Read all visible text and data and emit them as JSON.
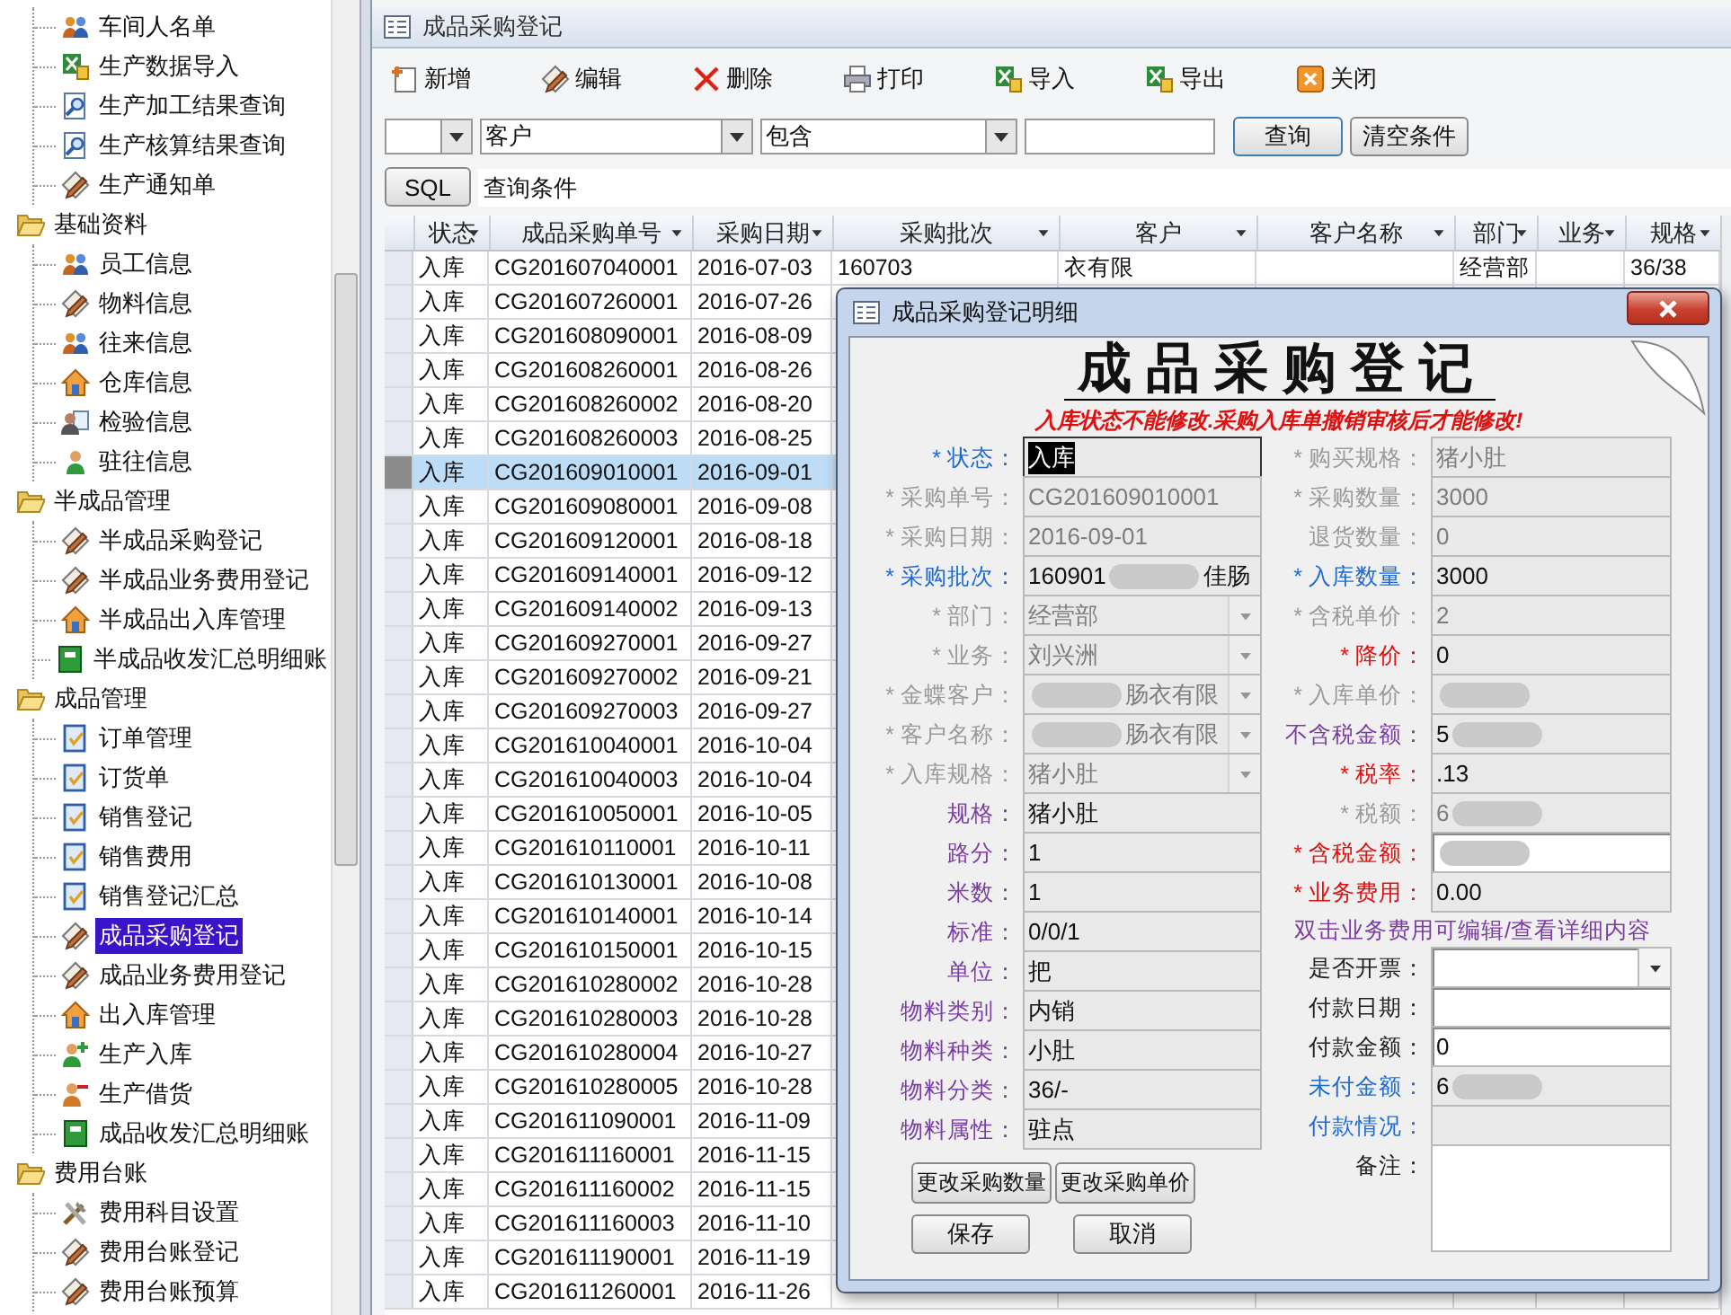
{
  "tree": [
    {
      "expanded": true,
      "children": [
        {
          "label": "车间人名单",
          "kind": "people",
          "selected": false
        },
        {
          "label": "生产数据导入",
          "kind": "excel",
          "selected": false
        },
        {
          "label": "生产加工结果查询",
          "kind": "search-doc",
          "selected": false
        },
        {
          "label": "生产核算结果查询",
          "kind": "search-doc",
          "selected": false
        },
        {
          "label": "生产通知单",
          "kind": "form",
          "selected": false
        }
      ]
    },
    {
      "label": "基础资料",
      "expanded": true,
      "children": [
        {
          "label": "员工信息",
          "kind": "people",
          "selected": false
        },
        {
          "label": "物料信息",
          "kind": "form",
          "selected": false
        },
        {
          "label": "往来信息",
          "kind": "people",
          "selected": false
        },
        {
          "label": "仓库信息",
          "kind": "house",
          "selected": false
        },
        {
          "label": "检验信息",
          "kind": "person-card",
          "selected": false
        },
        {
          "label": "驻往信息",
          "kind": "person",
          "selected": false
        }
      ]
    },
    {
      "label": "半成品管理",
      "expanded": true,
      "children": [
        {
          "label": "半成品采购登记",
          "kind": "form",
          "selected": false
        },
        {
          "label": "半成品业务费用登记",
          "kind": "form",
          "selected": false
        },
        {
          "label": "半成品出入库管理",
          "kind": "house",
          "selected": false
        },
        {
          "label": "半成品收发汇总明细账",
          "kind": "ledger",
          "selected": false
        }
      ]
    },
    {
      "label": "成品管理",
      "expanded": true,
      "children": [
        {
          "label": "订单管理",
          "kind": "check-doc",
          "selected": false
        },
        {
          "label": "订货单",
          "kind": "check-doc",
          "selected": false
        },
        {
          "label": "销售登记",
          "kind": "check-doc",
          "selected": false
        },
        {
          "label": "销售费用",
          "kind": "check-doc",
          "selected": false
        },
        {
          "label": "销售登记汇总",
          "kind": "check-doc",
          "selected": false
        },
        {
          "label": "成品采购登记",
          "kind": "form",
          "selected": true
        },
        {
          "label": "成品业务费用登记",
          "kind": "form",
          "selected": false
        },
        {
          "label": "出入库管理",
          "kind": "house",
          "selected": false
        },
        {
          "label": "生产入库",
          "kind": "person-add",
          "selected": false
        },
        {
          "label": "生产借货",
          "kind": "person-minus",
          "selected": false
        },
        {
          "label": "成品收发汇总明细账",
          "kind": "ledger",
          "selected": false
        }
      ]
    },
    {
      "label": "费用台账",
      "expanded": true,
      "children": [
        {
          "label": "费用科目设置",
          "kind": "tools",
          "selected": false
        },
        {
          "label": "费用台账登记",
          "kind": "form",
          "selected": false
        },
        {
          "label": "费用台账预算",
          "kind": "form",
          "selected": false
        }
      ]
    }
  ],
  "window": {
    "title": "成品采购登记"
  },
  "toolbar": [
    {
      "label": "新增",
      "kind": "new"
    },
    {
      "label": "编辑",
      "kind": "form"
    },
    {
      "label": "删除",
      "kind": "delete"
    },
    {
      "label": "打印",
      "kind": "print"
    },
    {
      "label": "导入",
      "kind": "excel"
    },
    {
      "label": "导出",
      "kind": "excel"
    },
    {
      "label": "关闭",
      "kind": "close"
    }
  ],
  "filters": {
    "field": "客户",
    "operator": "包含",
    "search_button": "查询",
    "clear_button": "清空条件",
    "sql_button": "SQL",
    "condition": "查询条件"
  },
  "table": {
    "columns": [
      "状态",
      "成品采购单号",
      "采购日期",
      "采购批次",
      "客户",
      "客户名称",
      "部门",
      "业务",
      "规格"
    ],
    "rows": [
      {
        "status": "入库",
        "number": "CG201607040001",
        "date": "2016-07-03",
        "batch": "160703",
        "customer": "衣有限",
        "department": "经营部",
        "spec": "36/38",
        "selected": false
      },
      {
        "status": "入库",
        "number": "CG201607260001",
        "date": "2016-07-26",
        "selected": false
      },
      {
        "status": "入库",
        "number": "CG201608090001",
        "date": "2016-08-09",
        "selected": false
      },
      {
        "status": "入库",
        "number": "CG201608260001",
        "date": "2016-08-26",
        "selected": false
      },
      {
        "status": "入库",
        "number": "CG201608260002",
        "date": "2016-08-20",
        "selected": false
      },
      {
        "status": "入库",
        "number": "CG201608260003",
        "date": "2016-08-25",
        "selected": false
      },
      {
        "status": "入库",
        "number": "CG201609010001",
        "date": "2016-09-01",
        "selected": true
      },
      {
        "status": "入库",
        "number": "CG201609080001",
        "date": "2016-09-08",
        "selected": false
      },
      {
        "status": "入库",
        "number": "CG201609120001",
        "date": "2016-08-18",
        "selected": false
      },
      {
        "status": "入库",
        "number": "CG201609140001",
        "date": "2016-09-12",
        "selected": false
      },
      {
        "status": "入库",
        "number": "CG201609140002",
        "date": "2016-09-13",
        "selected": false
      },
      {
        "status": "入库",
        "number": "CG201609270001",
        "date": "2016-09-27",
        "selected": false
      },
      {
        "status": "入库",
        "number": "CG201609270002",
        "date": "2016-09-21",
        "selected": false
      },
      {
        "status": "入库",
        "number": "CG201609270003",
        "date": "2016-09-27",
        "selected": false
      },
      {
        "status": "入库",
        "number": "CG201610040001",
        "date": "2016-10-04",
        "selected": false
      },
      {
        "status": "入库",
        "number": "CG201610040003",
        "date": "2016-10-04",
        "selected": false
      },
      {
        "status": "入库",
        "number": "CG201610050001",
        "date": "2016-10-05",
        "selected": false
      },
      {
        "status": "入库",
        "number": "CG201610110001",
        "date": "2016-10-11",
        "selected": false
      },
      {
        "status": "入库",
        "number": "CG201610130001",
        "date": "2016-10-08",
        "selected": false
      },
      {
        "status": "入库",
        "number": "CG201610140001",
        "date": "2016-10-14",
        "selected": false
      },
      {
        "status": "入库",
        "number": "CG201610150001",
        "date": "2016-10-15",
        "selected": false
      },
      {
        "status": "入库",
        "number": "CG201610280002",
        "date": "2016-10-28",
        "selected": false
      },
      {
        "status": "入库",
        "number": "CG201610280003",
        "date": "2016-10-28",
        "selected": false
      },
      {
        "status": "入库",
        "number": "CG201610280004",
        "date": "2016-10-27",
        "selected": false
      },
      {
        "status": "入库",
        "number": "CG201610280005",
        "date": "2016-10-28",
        "selected": false
      },
      {
        "status": "入库",
        "number": "CG201611090001",
        "date": "2016-11-09",
        "selected": false
      },
      {
        "status": "入库",
        "number": "CG201611160001",
        "date": "2016-11-15",
        "selected": false
      },
      {
        "status": "入库",
        "number": "CG201611160002",
        "date": "2016-11-15",
        "selected": false
      },
      {
        "status": "入库",
        "number": "CG201611160003",
        "date": "2016-11-10",
        "selected": false
      },
      {
        "status": "入库",
        "number": "CG201611190001",
        "date": "2016-11-19",
        "selected": false
      },
      {
        "status": "入库",
        "number": "CG201611260001",
        "date": "2016-11-26",
        "selected": false
      }
    ]
  },
  "detail": {
    "title": "成品采购登记明细",
    "heading": "成品采购登记",
    "notice": "入库状态不能修改.采购入库单撤销审核后才能修改!",
    "left_fields": [
      {
        "label": "* 状态：",
        "kind": "required",
        "value": "入库",
        "editable": false,
        "dropdown": false,
        "focused": true,
        "redacted": false
      },
      {
        "label": "* 采购单号：",
        "kind": "locked",
        "value": "CG201609010001",
        "editable": false,
        "dropdown": false,
        "focused": false,
        "redacted": false
      },
      {
        "label": "* 采购日期：",
        "kind": "locked",
        "value": "2016-09-01",
        "editable": false,
        "dropdown": false,
        "focused": false,
        "redacted": false
      },
      {
        "label": "* 采购批次：",
        "kind": "required",
        "value": "160901",
        "tail": "佳肠",
        "editable": false,
        "dropdown": false,
        "focused": false,
        "redacted": true
      },
      {
        "label": "* 部门：",
        "kind": "locked",
        "value": "经营部",
        "editable": false,
        "dropdown": true,
        "focused": false,
        "redacted": false
      },
      {
        "label": "* 业务：",
        "kind": "locked",
        "value": "刘兴洲",
        "editable": false,
        "dropdown": true,
        "focused": false,
        "redacted": false
      },
      {
        "label": "* 金蝶客户：",
        "kind": "locked",
        "tail": "肠衣有限",
        "editable": false,
        "dropdown": true,
        "focused": false,
        "redacted": true
      },
      {
        "label": "* 客户名称：",
        "kind": "locked",
        "tail": "肠衣有限",
        "editable": false,
        "dropdown": true,
        "focused": false,
        "redacted": true
      },
      {
        "label": "* 入库规格：",
        "kind": "locked",
        "value": "猪小肚",
        "editable": false,
        "dropdown": true,
        "focused": false,
        "redacted": false
      },
      {
        "label": "规格：",
        "kind": "info",
        "value": "猪小肚",
        "editable": false,
        "dropdown": false,
        "focused": false,
        "redacted": false
      },
      {
        "label": "路分：",
        "kind": "info",
        "value": "1",
        "editable": false,
        "dropdown": false,
        "focused": false,
        "redacted": false
      },
      {
        "label": "米数：",
        "kind": "info",
        "value": "1",
        "editable": false,
        "dropdown": false,
        "focused": false,
        "redacted": false
      },
      {
        "label": "标准：",
        "kind": "info",
        "value": "0/0/1",
        "editable": false,
        "dropdown": false,
        "focused": false,
        "redacted": false
      },
      {
        "label": "单位：",
        "kind": "info",
        "value": "把",
        "editable": false,
        "dropdown": false,
        "focused": false,
        "redacted": false
      },
      {
        "label": "物料类别：",
        "kind": "info",
        "value": "内销",
        "editable": false,
        "dropdown": false,
        "focused": false,
        "redacted": false
      },
      {
        "label": "物料种类：",
        "kind": "info",
        "value": "小肚",
        "editable": false,
        "dropdown": false,
        "focused": false,
        "redacted": false
      },
      {
        "label": "物料分类：",
        "kind": "info",
        "value": "36/-",
        "editable": false,
        "dropdown": false,
        "focused": false,
        "redacted": false
      },
      {
        "label": "物料属性：",
        "kind": "info",
        "value": "驻点",
        "editable": false,
        "dropdown": false,
        "focused": false,
        "redacted": false
      }
    ],
    "right_fields": [
      {
        "label": "* 购买规格：",
        "kind": "locked",
        "value": "猪小肚",
        "editable": false,
        "dropdown": false,
        "focused": false,
        "redacted": false
      },
      {
        "label": "* 采购数量：",
        "kind": "locked",
        "value": "3000",
        "editable": false,
        "dropdown": false,
        "focused": false,
        "redacted": false
      },
      {
        "label": "退货数量：",
        "kind": "locked",
        "value": "0",
        "editable": false,
        "dropdown": false,
        "focused": false,
        "redacted": false
      },
      {
        "label": "* 入库数量：",
        "kind": "required",
        "value": "3000",
        "editable": false,
        "dropdown": false,
        "focused": false,
        "redacted": false
      },
      {
        "label": "* 含税单价：",
        "kind": "locked",
        "value": "2",
        "editable": false,
        "dropdown": false,
        "focused": false,
        "redacted": false
      },
      {
        "label": "* 降价：",
        "kind": "alert",
        "value": "0",
        "editable": false,
        "dropdown": false,
        "focused": false,
        "redacted": false
      },
      {
        "label": "* 入库单价：",
        "kind": "locked",
        "editable": false,
        "dropdown": false,
        "focused": false,
        "redacted": true
      },
      {
        "label": "不含税金额：",
        "kind": "info",
        "value": "5",
        "editable": false,
        "dropdown": false,
        "focused": false,
        "redacted": true
      },
      {
        "label": "* 税率：",
        "kind": "alert",
        "value": ".13",
        "editable": false,
        "dropdown": false,
        "focused": false,
        "redacted": false
      },
      {
        "label": "* 税额：",
        "kind": "locked",
        "value": "6",
        "editable": false,
        "dropdown": false,
        "focused": false,
        "redacted": true
      },
      {
        "label": "* 含税金额：",
        "kind": "alert",
        "editable": true,
        "dropdown": false,
        "focused": false,
        "redacted": true
      },
      {
        "label": "* 业务费用：",
        "kind": "alert",
        "value": "0.00",
        "editable": false,
        "dropdown": false,
        "focused": false,
        "redacted": false
      }
    ],
    "hint": "双击业务费用可编辑/查看详细内容",
    "payment_fields": [
      {
        "label": "是否开票：",
        "kind": "plain",
        "editable": true,
        "dropdown": true,
        "focused": false,
        "redacted": false
      },
      {
        "label": "付款日期：",
        "kind": "plain",
        "editable": true,
        "dropdown": false,
        "focused": false,
        "redacted": false
      },
      {
        "label": "付款金额：",
        "kind": "plain",
        "value": "0",
        "editable": true,
        "dropdown": false,
        "focused": false,
        "redacted": false
      },
      {
        "label": "未付金额：",
        "kind": "link",
        "value": "6",
        "editable": false,
        "dropdown": false,
        "focused": false,
        "redacted": true
      },
      {
        "label": "付款情况：",
        "kind": "link",
        "editable": false,
        "dropdown": false,
        "focused": false,
        "redacted": false
      }
    ],
    "remarks_label": "备注：",
    "change_buttons": [
      "更改采购数量",
      "更改采购单价"
    ],
    "action_buttons": [
      "保存",
      "取消"
    ]
  }
}
